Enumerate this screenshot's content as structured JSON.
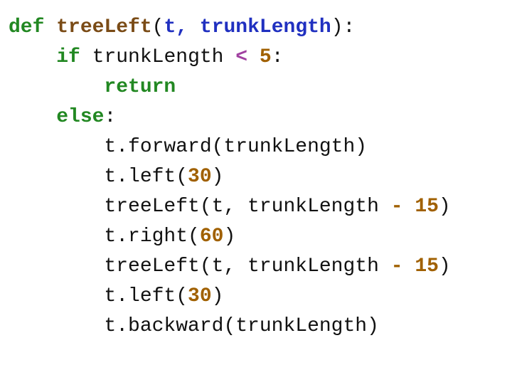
{
  "code": {
    "kw_def": "def",
    "fn_name": "treeLeft",
    "lparen": "(",
    "rparen": ")",
    "param_t": "t",
    "comma_sp": ", ",
    "param_trunk": "trunkLength",
    "colon": ":",
    "kw_if": "if",
    "sp": " ",
    "cond_var": "trunkLength ",
    "op_lt": "<",
    "sp_num5": " 5",
    "num_5": "5",
    "kw_return": "return",
    "kw_else": "else",
    "l5": "t.forward(trunkLength)",
    "l6a": "t.left(",
    "num_30": "30",
    "l6b": ")",
    "l7a": "treeLeft(t, trunkLength ",
    "op_minus": "-",
    "sp15": " ",
    "num_15": "15",
    "l7b": ")",
    "l8a": "t.right(",
    "num_60": "60",
    "l8b": ")",
    "l9a": "treeLeft(t, trunkLength ",
    "l9b": ")",
    "l10a": "t.left(",
    "l10b": ")",
    "l11": "t.backward(trunkLength)"
  },
  "indent": {
    "i1": "    ",
    "i2": "        "
  }
}
